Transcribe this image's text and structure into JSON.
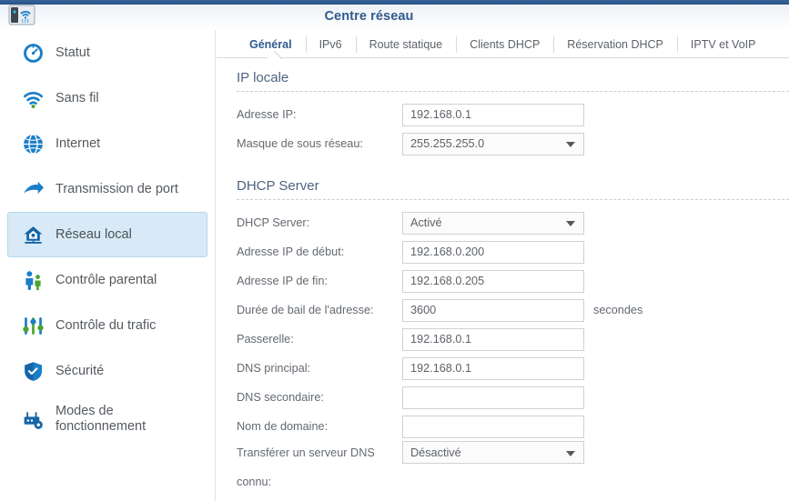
{
  "header": {
    "title": "Centre réseau",
    "logo_icon": "router-wifi-icon"
  },
  "sidebar": {
    "items": [
      {
        "label": "Statut",
        "icon": "gauge-icon",
        "selected": false
      },
      {
        "label": "Sans fil",
        "icon": "wifi-icon",
        "selected": false
      },
      {
        "label": "Internet",
        "icon": "globe-icon",
        "selected": false
      },
      {
        "label": "Transmission de port",
        "icon": "arrow-forward-icon",
        "selected": false
      },
      {
        "label": "Réseau local",
        "icon": "home-network-icon",
        "selected": true
      },
      {
        "label": "Contrôle parental",
        "icon": "people-icon",
        "selected": false
      },
      {
        "label": "Contrôle du trafic",
        "icon": "sliders-icon",
        "selected": false
      },
      {
        "label": "Sécurité",
        "icon": "shield-icon",
        "selected": false
      },
      {
        "label": "Modes de fonctionnement",
        "icon": "operation-mode-icon",
        "selected": false
      }
    ]
  },
  "tabs": [
    {
      "label": "Général",
      "active": true
    },
    {
      "label": "IPv6",
      "active": false
    },
    {
      "label": "Route statique",
      "active": false
    },
    {
      "label": "Clients DHCP",
      "active": false
    },
    {
      "label": "Réservation DHCP",
      "active": false
    },
    {
      "label": "IPTV et VoIP",
      "active": false
    }
  ],
  "sections": [
    {
      "title": "IP locale",
      "fields": [
        {
          "label": "Adresse IP:",
          "value": "192.168.0.1",
          "type": "text",
          "placeholder": ""
        },
        {
          "label": "Masque de sous réseau:",
          "value": "255.255.255.0",
          "type": "select",
          "placeholder": ""
        }
      ]
    },
    {
      "title": "DHCP Server",
      "fields": [
        {
          "label": "DHCP Server:",
          "value": "Activé",
          "type": "select",
          "placeholder": ""
        },
        {
          "label": "Adresse IP de début:",
          "value": "192.168.0.200",
          "type": "text",
          "placeholder": ""
        },
        {
          "label": "Adresse IP de fin:",
          "value": "192.168.0.205",
          "type": "text",
          "placeholder": ""
        },
        {
          "label": "Durée de bail de l'adresse:",
          "value": "3600",
          "type": "text",
          "suffix": "secondes",
          "placeholder": ""
        },
        {
          "label": "Passerelle:",
          "value": "192.168.0.1",
          "type": "text",
          "placeholder": ""
        },
        {
          "label": "DNS principal:",
          "value": "192.168.0.1",
          "type": "text",
          "placeholder": ""
        },
        {
          "label": "DNS secondaire:",
          "value": "",
          "type": "text",
          "placeholder": ""
        },
        {
          "label": "Nom de domaine:",
          "value": "",
          "type": "text",
          "placeholder": ""
        },
        {
          "label": "Transférer un serveur DNS",
          "label_continued": "connu:",
          "value": "Désactivé",
          "type": "select",
          "placeholder": ""
        }
      ]
    }
  ],
  "colors": {
    "top_strip": "#2e5c8a",
    "title_blue": "#2f5b8e",
    "section_heading": "#4e6480",
    "selected_nav_bg": "#d8eaf7",
    "selected_nav_border": "#b7d7ed",
    "icon_blue": "#1a7ec8",
    "accent_green": "#4ba32f"
  }
}
